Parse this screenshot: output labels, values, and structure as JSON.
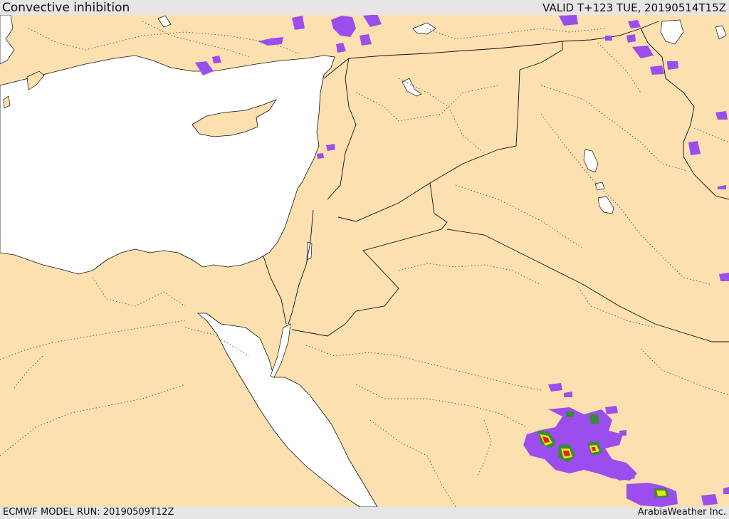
{
  "header": {
    "title": "Convective inhibition",
    "valid_time": "VALID T+123 TUE, 20190514T15Z"
  },
  "footer": {
    "model_run": "ECMWF MODEL RUN: 20190509T12Z",
    "credit": "ArabiaWeather Inc."
  },
  "colors": {
    "land": "#fce0b0",
    "water": "#ffffff",
    "cin_level_1": "#9b4dee",
    "cin_level_2": "#3a8a3a",
    "cin_level_3": "#e6e619",
    "cin_level_4": "#e62020",
    "borders": "#222222",
    "admin_lines": "#555555"
  }
}
